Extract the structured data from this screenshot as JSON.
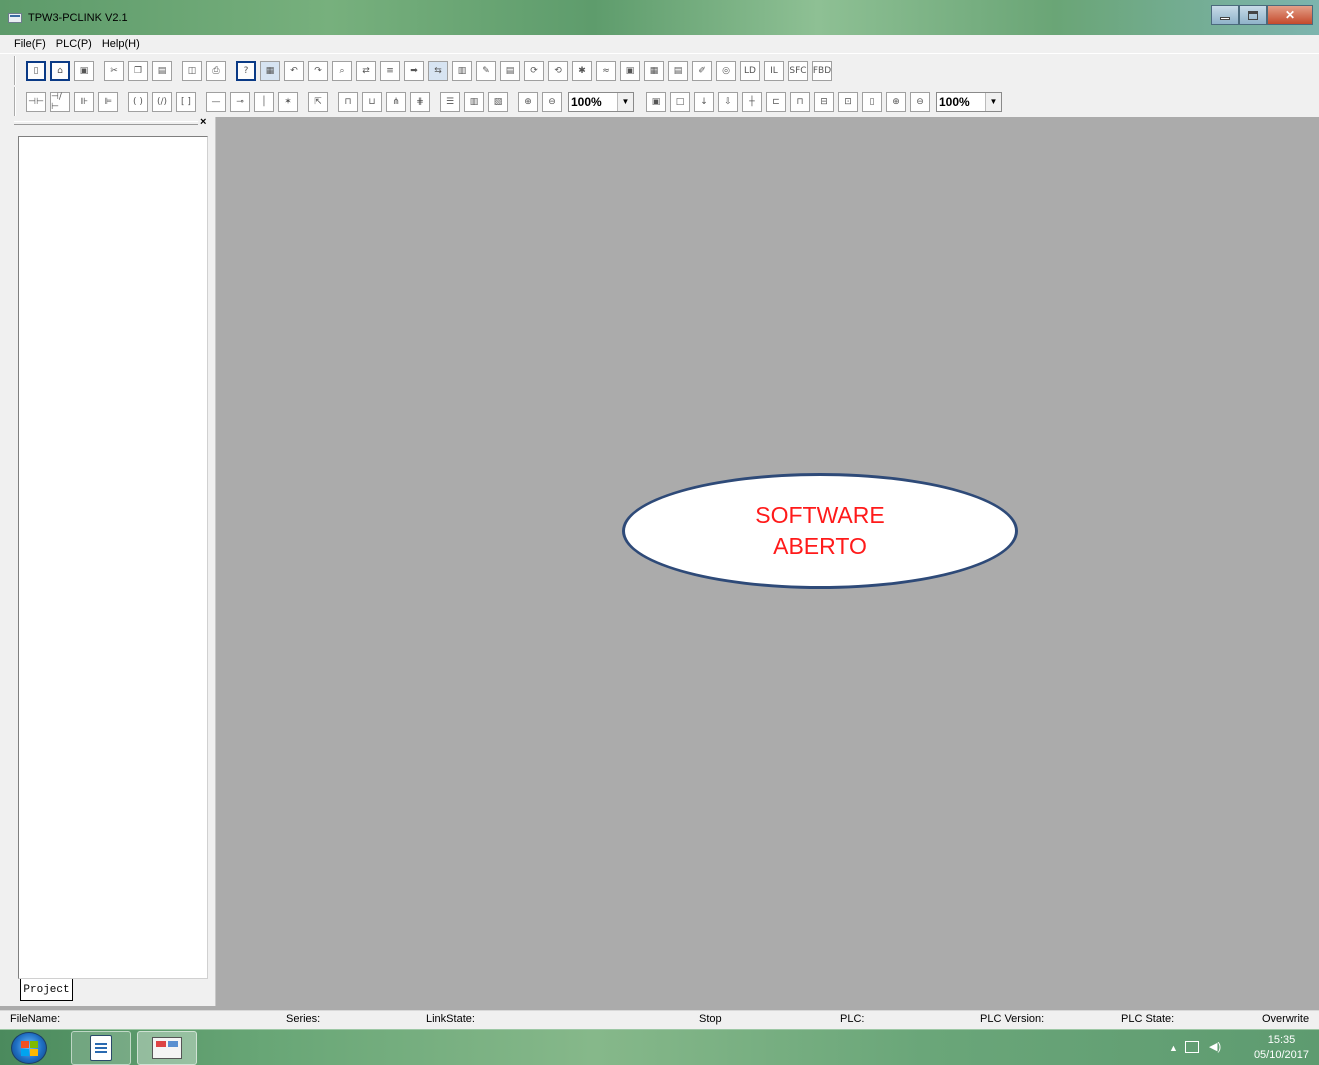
{
  "window": {
    "title": "TPW3-PCLINK V2.1"
  },
  "menu": [
    "File(F)",
    "PLC(P)",
    "Help(H)"
  ],
  "toolbar1": {
    "icons": [
      "new-file",
      "open-folder",
      "save",
      "cut",
      "copy",
      "paste",
      "print-preview",
      "print",
      "help",
      "monitor",
      "undo",
      "redo",
      "find",
      "replace",
      "find-next",
      "goto",
      "comm",
      "cross-ref",
      "edit-1",
      "edit-2",
      "convert",
      "transfer",
      "settings",
      "wave",
      "device-1",
      "device-2",
      "device-3",
      "edit-3",
      "monitor-2",
      "ld",
      "il",
      "sfc",
      "fbd"
    ],
    "text_labels": {
      "ld": "LD",
      "il": "IL",
      "sfc": "SFC",
      "fbd": "FBD"
    }
  },
  "toolbar2": {
    "zoom1": "100%",
    "zoom2": "100%"
  },
  "panel": {
    "close": "×",
    "tab": "Project"
  },
  "callout": {
    "line1": "SOFTWARE",
    "line2": "ABERTO"
  },
  "status": {
    "filename": "FileName:",
    "series": "Series:",
    "linkstate": "LinkState:",
    "stop": "Stop",
    "plc": "PLC:",
    "plc_version": "PLC Version:",
    "plc_state": "PLC State:",
    "overwrite": "Overwrite"
  },
  "taskbar": {
    "time": "15:35",
    "date": "05/10/2017"
  }
}
